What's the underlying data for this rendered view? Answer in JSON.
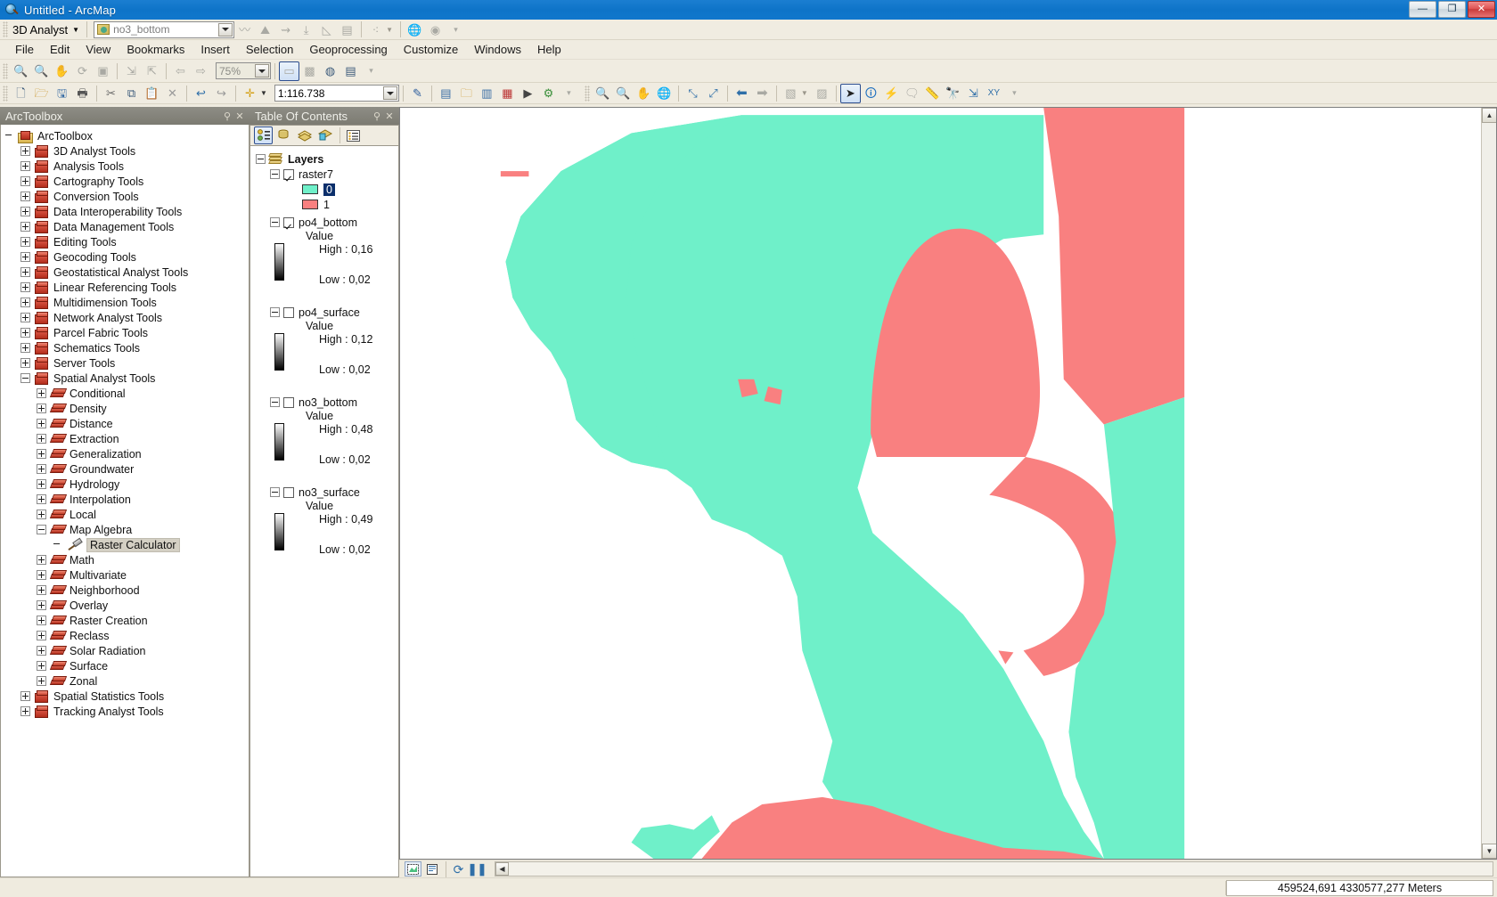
{
  "window": {
    "title": "Untitled - ArcMap",
    "app_icon": "arcmap-globe-icon",
    "minimize_label": "—",
    "maximize_label": "❐",
    "close_label": "✕"
  },
  "extension_toolbar": {
    "dropdown_label": "3D Analyst",
    "layer_combo_value": "no3_bottom",
    "buttons": [
      {
        "name": "interpolate-line-icon"
      },
      {
        "name": "profile-graph-icon"
      },
      {
        "name": "steepest-path-icon"
      },
      {
        "name": "line-of-sight-icon"
      },
      {
        "name": "create-tin-icon"
      },
      {
        "name": "surface-layer-icon"
      },
      {
        "name": "scatter-icon"
      },
      {
        "name": "globe-view-icon"
      },
      {
        "name": "arcscene-icon"
      }
    ]
  },
  "effects_toolbar": {
    "zoom_value": "75%",
    "buttons": [
      {
        "name": "zoom-in-icon"
      },
      {
        "name": "zoom-out-icon"
      },
      {
        "name": "pan-icon"
      },
      {
        "name": "refresh-icon"
      },
      {
        "name": "fixed-zoom-icon"
      },
      {
        "name": "collapse-icon"
      },
      {
        "name": "expand-icon"
      },
      {
        "name": "previous-extent-icon"
      },
      {
        "name": "next-extent-icon"
      },
      {
        "name": "swipe-icon"
      },
      {
        "name": "flicker-icon"
      },
      {
        "name": "transparency-icon"
      },
      {
        "name": "layer-effects-icon"
      }
    ]
  },
  "menubar": {
    "items": [
      {
        "label": "File"
      },
      {
        "label": "Edit"
      },
      {
        "label": "View"
      },
      {
        "label": "Bookmarks"
      },
      {
        "label": "Insert"
      },
      {
        "label": "Selection"
      },
      {
        "label": "Geoprocessing"
      },
      {
        "label": "Customize"
      },
      {
        "label": "Windows"
      },
      {
        "label": "Help"
      }
    ]
  },
  "standard_toolbar": {
    "scale_value": "1:116.738",
    "buttons": [
      {
        "name": "new-document-icon"
      },
      {
        "name": "open-icon"
      },
      {
        "name": "save-icon"
      },
      {
        "name": "print-icon"
      },
      {
        "name": "cut-icon"
      },
      {
        "name": "copy-icon"
      },
      {
        "name": "paste-icon"
      },
      {
        "name": "delete-icon"
      },
      {
        "name": "undo-icon"
      },
      {
        "name": "redo-icon"
      },
      {
        "name": "add-data-icon"
      },
      {
        "name": "editor-toolbar-icon"
      },
      {
        "name": "table-of-contents-icon"
      },
      {
        "name": "catalog-icon"
      },
      {
        "name": "search-window-icon"
      },
      {
        "name": "arctoolbox-icon"
      },
      {
        "name": "python-window-icon"
      },
      {
        "name": "modelbuilder-icon"
      }
    ]
  },
  "tools_toolbar": {
    "buttons": [
      {
        "name": "zoom-in-icon"
      },
      {
        "name": "zoom-out-icon"
      },
      {
        "name": "pan-icon"
      },
      {
        "name": "full-extent-icon"
      },
      {
        "name": "fixed-zoom-in-icon"
      },
      {
        "name": "fixed-zoom-out-icon"
      },
      {
        "name": "back-extent-icon"
      },
      {
        "name": "forward-extent-icon"
      },
      {
        "name": "select-features-icon"
      },
      {
        "name": "clear-selection-icon"
      },
      {
        "name": "select-elements-icon"
      },
      {
        "name": "identify-icon"
      },
      {
        "name": "hyperlink-icon"
      },
      {
        "name": "html-popup-icon"
      },
      {
        "name": "measure-icon"
      },
      {
        "name": "find-icon"
      },
      {
        "name": "find-route-icon"
      },
      {
        "name": "go-to-xy-icon"
      }
    ]
  },
  "arctoolbox_panel": {
    "title": "ArcToolbox",
    "autohide_icon": "pin-icon",
    "close_icon": "close-icon",
    "tree": [
      {
        "label": "ArcToolbox",
        "icon": "arctoolbox-root-icon",
        "level": 0,
        "state": "root"
      },
      {
        "label": "3D Analyst Tools",
        "icon": "toolbox-icon",
        "level": 1,
        "state": "collapsed"
      },
      {
        "label": "Analysis Tools",
        "icon": "toolbox-icon",
        "level": 1,
        "state": "collapsed"
      },
      {
        "label": "Cartography Tools",
        "icon": "toolbox-icon",
        "level": 1,
        "state": "collapsed"
      },
      {
        "label": "Conversion Tools",
        "icon": "toolbox-icon",
        "level": 1,
        "state": "collapsed"
      },
      {
        "label": "Data Interoperability Tools",
        "icon": "toolbox-icon",
        "level": 1,
        "state": "collapsed"
      },
      {
        "label": "Data Management Tools",
        "icon": "toolbox-icon",
        "level": 1,
        "state": "collapsed"
      },
      {
        "label": "Editing Tools",
        "icon": "toolbox-icon",
        "level": 1,
        "state": "collapsed"
      },
      {
        "label": "Geocoding Tools",
        "icon": "toolbox-icon",
        "level": 1,
        "state": "collapsed"
      },
      {
        "label": "Geostatistical Analyst Tools",
        "icon": "toolbox-icon",
        "level": 1,
        "state": "collapsed"
      },
      {
        "label": "Linear Referencing Tools",
        "icon": "toolbox-icon",
        "level": 1,
        "state": "collapsed"
      },
      {
        "label": "Multidimension Tools",
        "icon": "toolbox-icon",
        "level": 1,
        "state": "collapsed"
      },
      {
        "label": "Network Analyst Tools",
        "icon": "toolbox-icon",
        "level": 1,
        "state": "collapsed"
      },
      {
        "label": "Parcel Fabric Tools",
        "icon": "toolbox-icon",
        "level": 1,
        "state": "collapsed"
      },
      {
        "label": "Schematics Tools",
        "icon": "toolbox-icon",
        "level": 1,
        "state": "collapsed"
      },
      {
        "label": "Server Tools",
        "icon": "toolbox-icon",
        "level": 1,
        "state": "collapsed"
      },
      {
        "label": "Spatial Analyst Tools",
        "icon": "toolbox-icon",
        "level": 1,
        "state": "expanded"
      },
      {
        "label": "Conditional",
        "icon": "toolset-icon",
        "level": 2,
        "state": "collapsed"
      },
      {
        "label": "Density",
        "icon": "toolset-icon",
        "level": 2,
        "state": "collapsed"
      },
      {
        "label": "Distance",
        "icon": "toolset-icon",
        "level": 2,
        "state": "collapsed"
      },
      {
        "label": "Extraction",
        "icon": "toolset-icon",
        "level": 2,
        "state": "collapsed"
      },
      {
        "label": "Generalization",
        "icon": "toolset-icon",
        "level": 2,
        "state": "collapsed"
      },
      {
        "label": "Groundwater",
        "icon": "toolset-icon",
        "level": 2,
        "state": "collapsed"
      },
      {
        "label": "Hydrology",
        "icon": "toolset-icon",
        "level": 2,
        "state": "collapsed"
      },
      {
        "label": "Interpolation",
        "icon": "toolset-icon",
        "level": 2,
        "state": "collapsed"
      },
      {
        "label": "Local",
        "icon": "toolset-icon",
        "level": 2,
        "state": "collapsed"
      },
      {
        "label": "Map Algebra",
        "icon": "toolset-icon",
        "level": 2,
        "state": "expanded"
      },
      {
        "label": "Raster Calculator",
        "icon": "tool-hammer-icon",
        "level": 3,
        "state": "leaf",
        "selected": true
      },
      {
        "label": "Math",
        "icon": "toolset-icon",
        "level": 2,
        "state": "collapsed"
      },
      {
        "label": "Multivariate",
        "icon": "toolset-icon",
        "level": 2,
        "state": "collapsed"
      },
      {
        "label": "Neighborhood",
        "icon": "toolset-icon",
        "level": 2,
        "state": "collapsed"
      },
      {
        "label": "Overlay",
        "icon": "toolset-icon",
        "level": 2,
        "state": "collapsed"
      },
      {
        "label": "Raster Creation",
        "icon": "toolset-icon",
        "level": 2,
        "state": "collapsed"
      },
      {
        "label": "Reclass",
        "icon": "toolset-icon",
        "level": 2,
        "state": "collapsed"
      },
      {
        "label": "Solar Radiation",
        "icon": "toolset-icon",
        "level": 2,
        "state": "collapsed"
      },
      {
        "label": "Surface",
        "icon": "toolset-icon",
        "level": 2,
        "state": "collapsed"
      },
      {
        "label": "Zonal",
        "icon": "toolset-icon",
        "level": 2,
        "state": "collapsed"
      },
      {
        "label": "Spatial Statistics Tools",
        "icon": "toolbox-icon",
        "level": 1,
        "state": "collapsed"
      },
      {
        "label": "Tracking Analyst Tools",
        "icon": "toolbox-icon",
        "level": 1,
        "state": "collapsed"
      }
    ]
  },
  "toc_panel": {
    "title": "Table Of Contents",
    "autohide_icon": "pin-icon",
    "close_icon": "close-icon",
    "toolbar_buttons": [
      {
        "name": "list-by-drawing-order-icon",
        "active": true
      },
      {
        "name": "list-by-source-icon",
        "active": false
      },
      {
        "name": "list-by-visibility-icon",
        "active": false
      },
      {
        "name": "list-by-selection-icon",
        "active": false
      },
      {
        "name": "toc-options-icon",
        "active": false
      }
    ],
    "root_label": "Layers",
    "layers": [
      {
        "name": "raster7",
        "checked": true,
        "expanded": true,
        "legend_type": "unique_values",
        "classes": [
          {
            "label": "0",
            "color": "#6ff0c9",
            "selected": true
          },
          {
            "label": "1",
            "color": "#f98080",
            "selected": false
          }
        ]
      },
      {
        "name": "po4_bottom",
        "checked": true,
        "expanded": true,
        "legend_type": "stretched",
        "value_label": "Value",
        "high_label": "High : 0,16",
        "low_label": "Low : 0,02"
      },
      {
        "name": "po4_surface",
        "checked": false,
        "expanded": true,
        "legend_type": "stretched",
        "value_label": "Value",
        "high_label": "High : 0,12",
        "low_label": "Low : 0,02"
      },
      {
        "name": "no3_bottom",
        "checked": false,
        "expanded": true,
        "legend_type": "stretched",
        "value_label": "Value",
        "high_label": "High : 0,48",
        "low_label": "Low : 0,02"
      },
      {
        "name": "no3_surface",
        "checked": false,
        "expanded": true,
        "legend_type": "stretched",
        "value_label": "Value",
        "high_label": "High : 0,49",
        "low_label": "Low : 0,02"
      }
    ]
  },
  "map": {
    "background_color": "#ffffff",
    "class_0_color": "#6ff0c9",
    "class_1_color": "#f98080",
    "bottom_buttons": [
      {
        "name": "data-view-icon",
        "active": true
      },
      {
        "name": "layout-view-icon",
        "active": false
      },
      {
        "name": "refresh-view-icon",
        "active": false
      },
      {
        "name": "pause-drawing-icon",
        "active": false
      }
    ],
    "scroll_left_icon": "scroll-left-icon",
    "scroll_up_icon": "scroll-up-icon",
    "scroll_down_icon": "scroll-down-icon"
  },
  "statusbar": {
    "message": "",
    "coordinates": "459524,691  4330577,277 Meters"
  }
}
